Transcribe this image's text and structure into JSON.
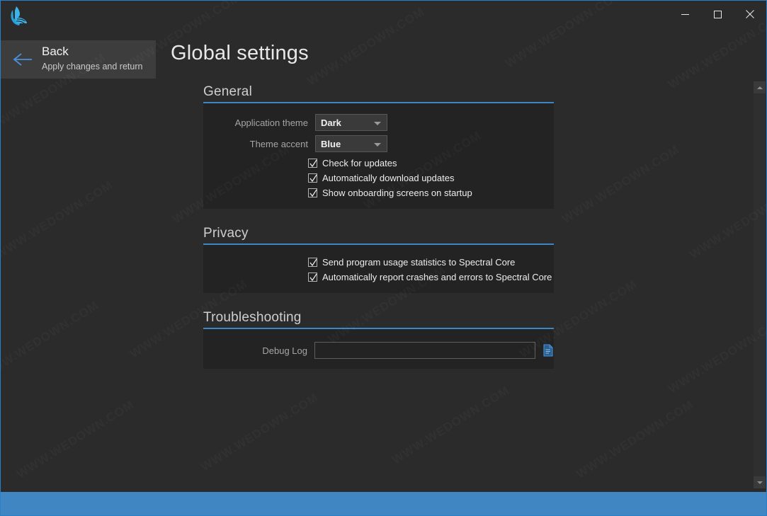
{
  "window": {
    "accent_color": "#3b87c6",
    "background_color": "#2b2b2b",
    "panel_color": "#232323",
    "statusbar_color": "#3f86c3"
  },
  "titlebar": {
    "logo_icon": "spectral-core-logo-icon",
    "minimize_label": "—",
    "maximize_label": "☐",
    "close_label": "✕"
  },
  "back_button": {
    "title": "Back",
    "subtitle": "Apply changes and return",
    "icon": "arrow-left-icon"
  },
  "page": {
    "title": "Global settings"
  },
  "sections": {
    "general": {
      "header": "General",
      "fields": [
        {
          "label": "Application theme",
          "value": "Dark",
          "options": [
            "Dark"
          ]
        },
        {
          "label": "Theme accent",
          "value": "Blue",
          "options": [
            "Blue"
          ]
        }
      ],
      "checkboxes": [
        {
          "label": "Check for updates",
          "checked": true
        },
        {
          "label": "Automatically download updates",
          "checked": true
        },
        {
          "label": "Show onboarding screens on startup",
          "checked": true
        }
      ]
    },
    "privacy": {
      "header": "Privacy",
      "checkboxes": [
        {
          "label": "Send program usage statistics to Spectral Core",
          "checked": true
        },
        {
          "label": "Automatically report crashes and errors to Spectral Core",
          "checked": true
        }
      ]
    },
    "troubleshooting": {
      "header": "Troubleshooting",
      "debug_log": {
        "label": "Debug Log",
        "value": "",
        "placeholder": "",
        "browse_icon": "file-document-icon"
      }
    }
  },
  "scrollbar": {
    "up_icon": "scroll-up-arrow-icon",
    "down_icon": "scroll-down-arrow-icon"
  },
  "watermark": {
    "text": "WWW.WEDOWN.COM"
  }
}
